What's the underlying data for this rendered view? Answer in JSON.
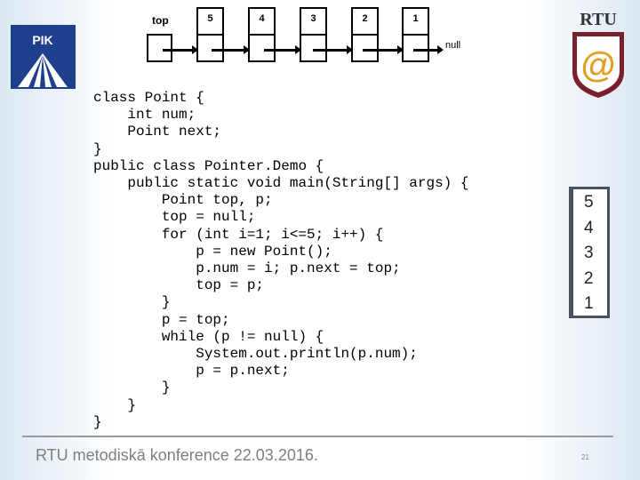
{
  "diagram": {
    "top_label": "top",
    "nodes": [
      "5",
      "4",
      "3",
      "2",
      "1"
    ],
    "null_label": "null"
  },
  "logos": {
    "left": "PIK",
    "right": "RTU"
  },
  "code": [
    "class Point {",
    "    int num;",
    "    Point next;",
    "}",
    "public class Pointer.Demo {",
    "    public static void main(String[] args) {",
    "        Point top, p;",
    "        top = null;",
    "        for (int i=1; i<=5; i++) {",
    "            p = new Point();",
    "            p.num = i; p.next = top;",
    "            top = p;",
    "        }",
    "        p = top;",
    "        while (p != null) {",
    "            System.out.println(p.num);",
    "            p = p.next;",
    "        }",
    "    }",
    "}"
  ],
  "output": [
    "5",
    "4",
    "3",
    "2",
    "1"
  ],
  "footer": {
    "text": "RTU metodiskā konference 22.03.2016.",
    "page": "21"
  }
}
